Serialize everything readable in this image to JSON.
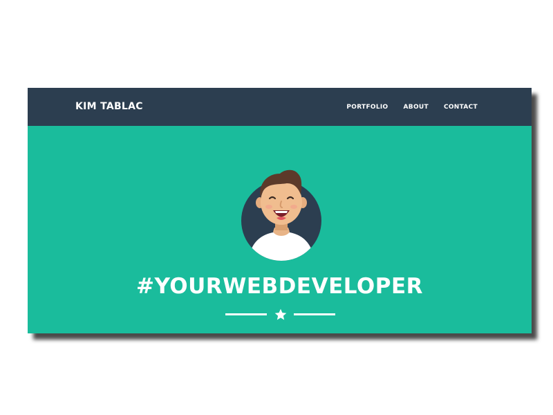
{
  "navbar": {
    "brand": "KIM TABLAC",
    "links": [
      {
        "label": "PORTFOLIO"
      },
      {
        "label": "ABOUT"
      },
      {
        "label": "CONTACT"
      }
    ]
  },
  "hero": {
    "headline": "#YOURWEBDEVELOPER",
    "avatar_icon": "smiling-man-avatar-icon",
    "divider_icon": "star-icon"
  },
  "colors": {
    "navbar_bg": "#2c3e50",
    "hero_bg": "#1abc9c",
    "text": "#ffffff"
  }
}
